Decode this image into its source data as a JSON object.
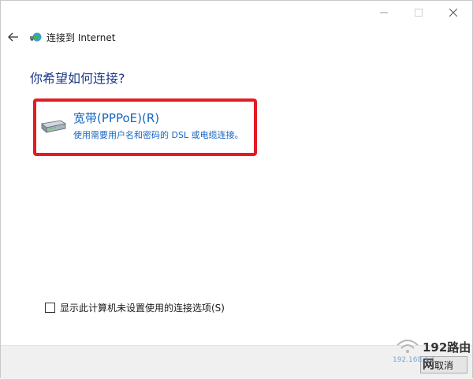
{
  "window": {
    "title": "连接到 Internet",
    "controls": {
      "minimize_icon": "minimize-icon",
      "maximize_icon": "maximize-icon",
      "close_icon": "close-icon"
    }
  },
  "nav": {
    "back_icon": "back-arrow-icon",
    "app_icon": "network-globe-icon"
  },
  "main": {
    "heading": "你希望如何连接?",
    "option": {
      "title": "宽带(PPPoE)(R)",
      "description": "使用需要用户名和密码的 DSL 或电缆连接。",
      "icon": "modem-icon"
    },
    "checkbox": {
      "label": "显示此计算机未设置使用的连接选项(S)",
      "checked": false
    }
  },
  "footer": {
    "cancel_label": "取消"
  },
  "watermark": {
    "text": "192路由网",
    "url": "192.168.1.1"
  },
  "colors": {
    "accent": "#1565c0",
    "highlight": "#e31b23",
    "heading": "#1d3a8a",
    "footer_bg": "#f0f0f0"
  }
}
